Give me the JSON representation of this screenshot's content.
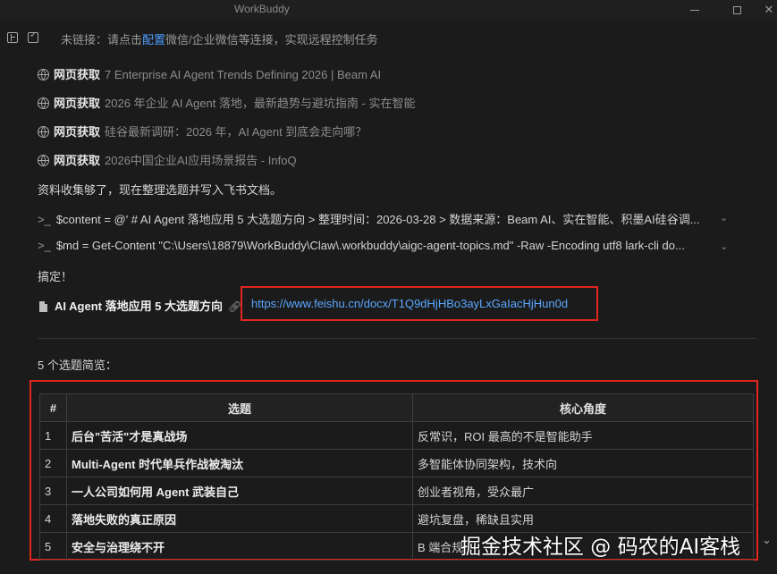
{
  "window": {
    "title": "WorkBuddy"
  },
  "notice": {
    "prefix": "未链接：请点击",
    "link": "配置",
    "suffix": "微信/企业微信等连接，实现远程控制任务"
  },
  "fetch_items": [
    {
      "label": "网页获取",
      "text": "7 Enterprise AI Agent Trends Defining 2026 | Beam AI"
    },
    {
      "label": "网页获取",
      "text": "2026 年企业 AI Agent 落地，最新趋势与避坑指南 - 实在智能"
    },
    {
      "label": "网页获取",
      "text": "硅谷最新调研：2026 年，AI Agent 到底会走向哪？"
    },
    {
      "label": "网页获取",
      "text": "2026中国企业AI应用场景报告 - InfoQ"
    }
  ],
  "status_collected": "资料收集够了，现在整理选题并写入飞书文档。",
  "commands": [
    {
      "prompt": ">_",
      "text": "$content = @' # AI Agent 落地应用 5 大选题方向 > 整理时间：2026-03-28 > 数据来源：Beam AI、实在智能、积墨AI硅谷调..."
    },
    {
      "prompt": ">_",
      "text": "$md = Get-Content \"C:\\Users\\18879\\WorkBuddy\\Claw\\.workbuddy\\aigc-agent-topics.md\" -Raw -Encoding utf8 lark-cli do..."
    }
  ],
  "status_done": "搞定！",
  "doc": {
    "title": "AI Agent 落地应用 5 大选题方向",
    "url": "https://www.feishu.cn/docx/T1Q9dHjHBo3ayLxGaIacHjHun0d"
  },
  "summary_label": "5 个选题简览：",
  "table": {
    "headers": [
      "#",
      "选题",
      "核心角度"
    ],
    "rows": [
      {
        "num": "1",
        "topic": "后台\"苦活\"才是真战场",
        "angle": "反常识，ROI 最高的不是智能助手"
      },
      {
        "num": "2",
        "topic": "Multi-Agent 时代单兵作战被淘汰",
        "angle": "多智能体协同架构，技术向"
      },
      {
        "num": "3",
        "topic": "一人公司如何用 Agent 武装自己",
        "angle": "创业者视角，受众最广"
      },
      {
        "num": "4",
        "topic": "落地失败的真正原因",
        "angle": "避坑复盘，稀缺且实用"
      },
      {
        "num": "5",
        "topic": "安全与治理绕不开",
        "angle": "B 端合规"
      }
    ]
  },
  "watermark": "掘金技术社区 @ 码农的AI客栈",
  "icons": [
    "toolbar-panel-icon",
    "toolbar-check-icon",
    "globe-icon",
    "terminal-icon",
    "chevron-down-icon",
    "document-icon",
    "link-icon"
  ],
  "colors": {
    "background": "#1b1b1b",
    "link": "#5aa7ff",
    "highlight_box": "#e0261e"
  }
}
